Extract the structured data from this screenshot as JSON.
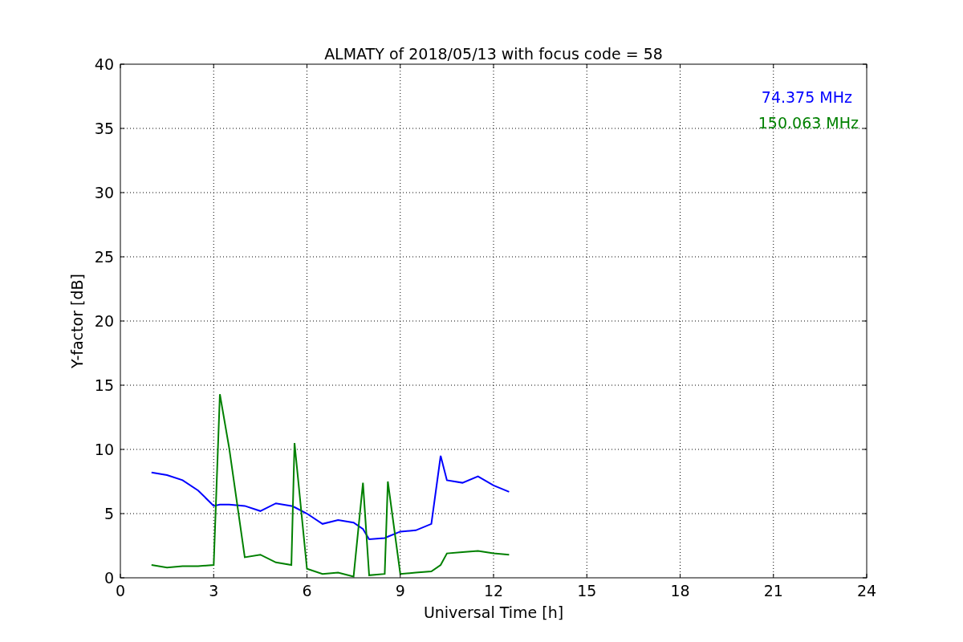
{
  "chart_data": {
    "type": "line",
    "title": "ALMATY of 2018/05/13 with focus code = 58",
    "xlabel": "Universal Time [h]",
    "ylabel": "Y-factor [dB]",
    "x": [
      1,
      1.5,
      2,
      2.5,
      3,
      3.2,
      3.5,
      4,
      4.5,
      5,
      5.5,
      5.6,
      6,
      6.5,
      7,
      7.5,
      7.8,
      8,
      8.5,
      8.6,
      9,
      9.5,
      10,
      10.3,
      10.5,
      11,
      11.5,
      12,
      12.5
    ],
    "series": [
      {
        "name": "74.375 MHz",
        "color": "#0000ff",
        "values": [
          8.2,
          8.0,
          7.6,
          6.8,
          5.6,
          5.7,
          5.7,
          5.6,
          5.2,
          5.8,
          5.6,
          5.5,
          5.0,
          4.2,
          4.5,
          4.3,
          3.8,
          3.0,
          3.1,
          3.2,
          3.6,
          3.7,
          4.2,
          9.5,
          7.6,
          7.4,
          7.9,
          7.2,
          6.7
        ]
      },
      {
        "name": "150.063 MHz",
        "color": "#008000",
        "values": [
          1.0,
          0.8,
          0.9,
          0.9,
          1.0,
          14.3,
          10.1,
          1.6,
          1.8,
          1.2,
          1.0,
          10.5,
          0.7,
          0.3,
          0.4,
          0.1,
          7.4,
          0.2,
          0.3,
          7.5,
          0.3,
          0.4,
          0.5,
          1.0,
          1.9,
          2.0,
          2.1,
          1.9,
          1.8
        ]
      }
    ],
    "xlim": [
      0,
      24
    ],
    "ylim": [
      0,
      40
    ],
    "xticks": [
      0,
      3,
      6,
      9,
      12,
      15,
      18,
      21,
      24
    ],
    "yticks": [
      0,
      5,
      10,
      15,
      20,
      25,
      30,
      35,
      40
    ],
    "grid": true
  }
}
